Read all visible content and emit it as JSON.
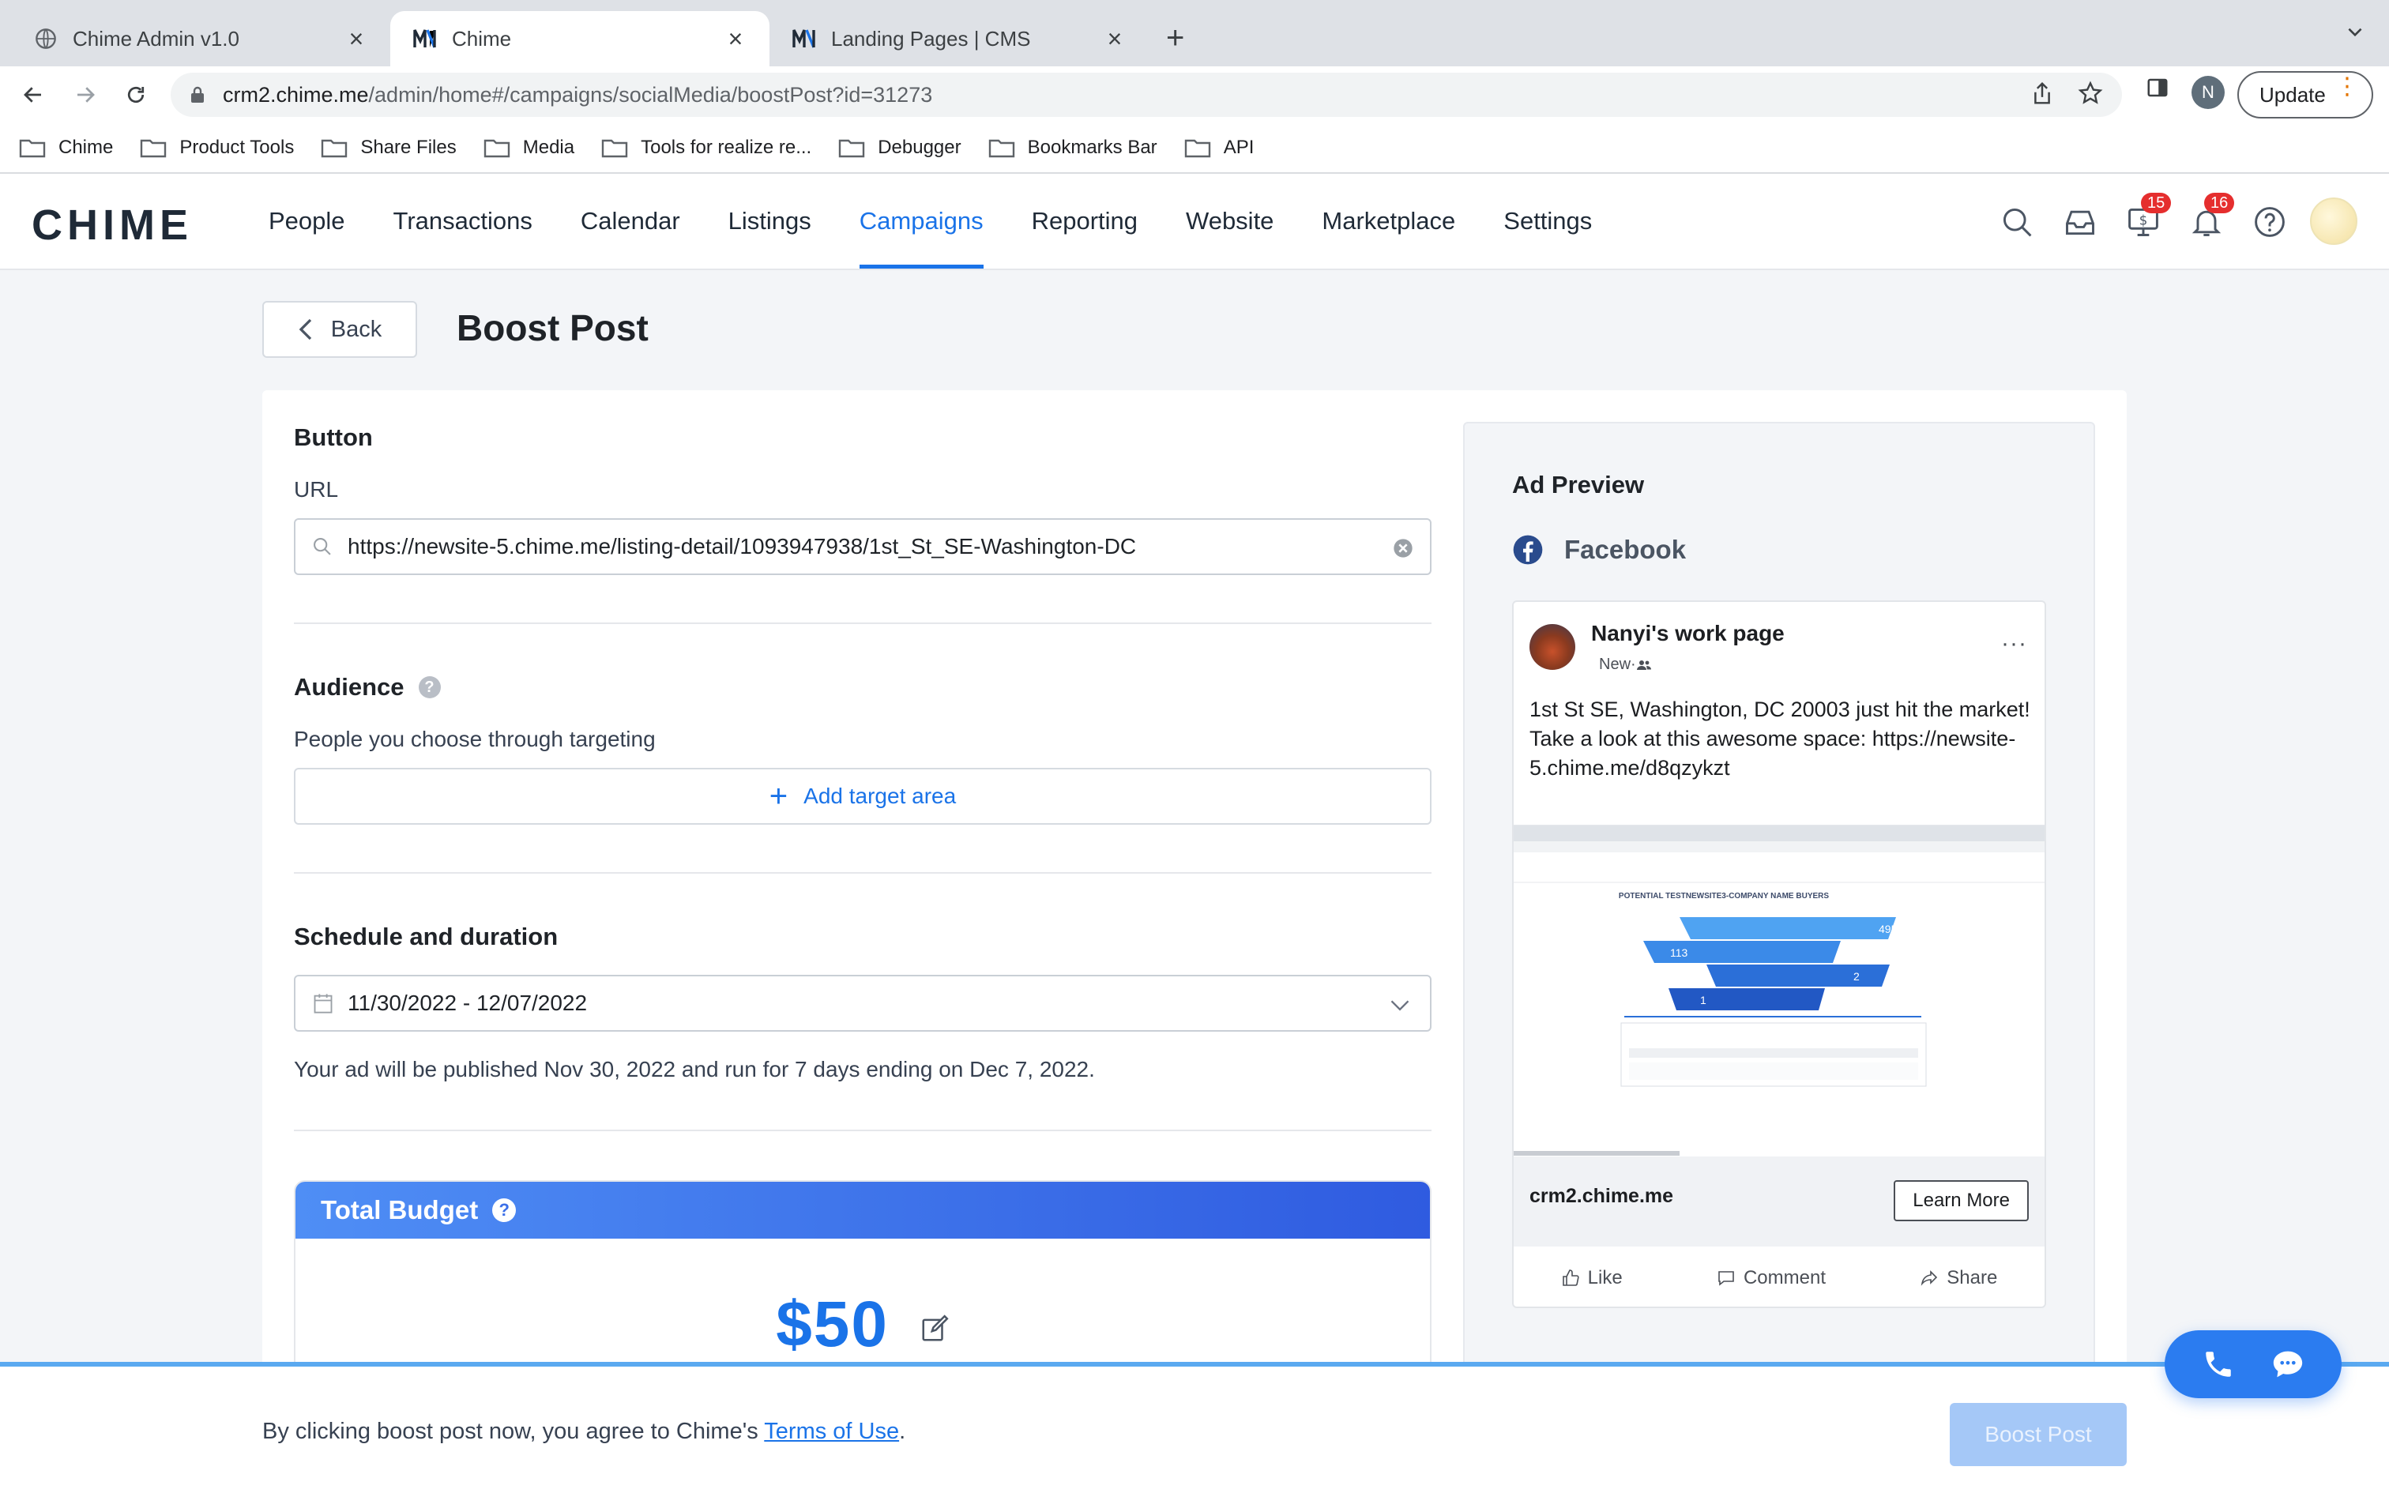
{
  "browser": {
    "tabs": [
      {
        "title": "Chime Admin v1.0",
        "icon": "globe-icon",
        "active": false
      },
      {
        "title": "Chime",
        "icon": "chime-m-icon",
        "active": true
      },
      {
        "title": "Landing Pages | CMS",
        "icon": "chime-m-icon",
        "active": false
      }
    ],
    "address": {
      "host": "crm2.chime.me",
      "path": "/admin/home#/campaigns/socialMedia/boostPost?id=31273"
    },
    "profile_initial": "N",
    "update_label": "Update",
    "bookmarks": [
      "Chime",
      "Product Tools",
      "Share Files",
      "Media",
      "Tools for realize re...",
      "Debugger",
      "Bookmarks Bar",
      "API"
    ]
  },
  "app": {
    "logo": "CHIME",
    "nav": [
      "People",
      "Transactions",
      "Calendar",
      "Listings",
      "Campaigns",
      "Reporting",
      "Website",
      "Marketplace",
      "Settings"
    ],
    "active_nav": "Campaigns",
    "badges": {
      "transactions": "15",
      "notifications": "16"
    }
  },
  "page": {
    "back_label": "Back",
    "title": "Boost Post"
  },
  "form": {
    "button_heading": "Button",
    "url_label": "URL",
    "url_value": "https://newsite-5.chime.me/listing-detail/1093947938/1st_St_SE-Washington-DC",
    "audience_heading": "Audience",
    "audience_help": "?",
    "audience_desc": "People you choose through targeting",
    "add_target_label": "Add target area",
    "schedule_heading": "Schedule and duration",
    "date_range": "11/30/2022 - 12/07/2022",
    "schedule_note": "Your ad will be published Nov 30, 2022 and run for 7 days ending on Dec 7, 2022.",
    "budget_heading": "Total Budget",
    "budget_help": "?",
    "budget_amount": "$50"
  },
  "preview": {
    "heading": "Ad Preview",
    "platform": "Facebook",
    "page_name": "Nanyi's work page",
    "post_meta": "New·",
    "more": "···",
    "post_text_1": "1st St SE, Washington, DC 20003 just hit the market!",
    "post_text_2": "Take a look at this awesome space: https://newsite-5.chime.me/d8qzykzt",
    "link_domain": "crm2.chime.me",
    "cta_label": "Learn More",
    "actions": [
      "Like",
      "Comment",
      "Share"
    ],
    "image": {
      "heading": "POTENTIAL TESTNEWSITE3-COMPANY NAME BUYERS",
      "funnel_values": [
        "495",
        "113",
        "2",
        "1"
      ]
    }
  },
  "footer": {
    "terms_prefix": "By clicking boost post now, you agree to Chime's ",
    "terms_link": "Terms of Use",
    "terms_suffix": ".",
    "boost_label": "Boost Post"
  },
  "colors": {
    "accent": "#1a73e8",
    "badge": "#e52e2e",
    "budget_gradient_start": "#4f8ef5",
    "budget_gradient_end": "#2f5be0"
  }
}
